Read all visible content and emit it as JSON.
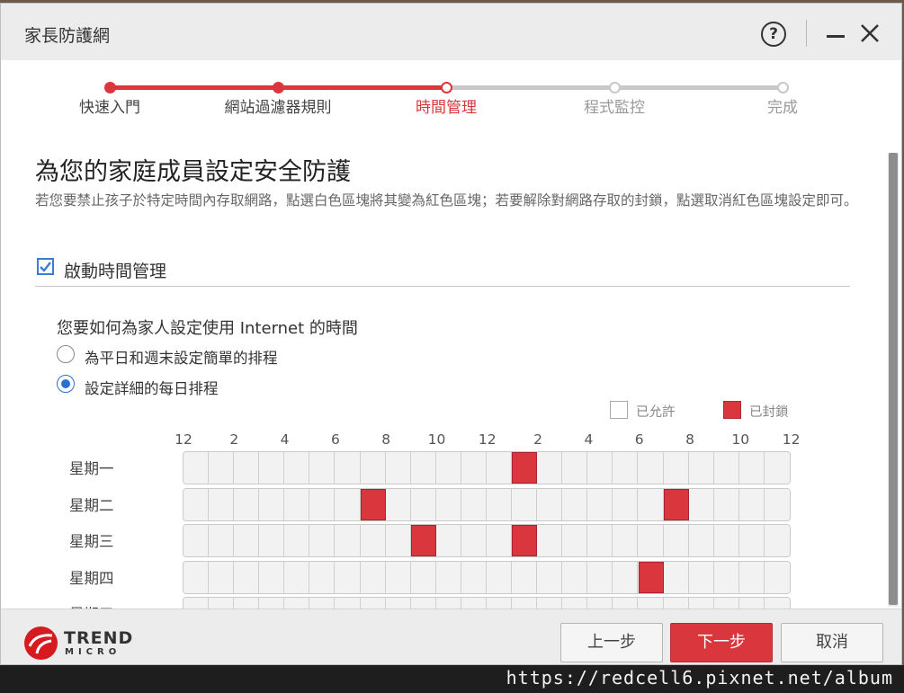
{
  "window": {
    "title": "家長防護網",
    "help_glyph": "?"
  },
  "steps": [
    {
      "label": "快速入門",
      "state": "done"
    },
    {
      "label": "網站過濾器規則",
      "state": "done"
    },
    {
      "label": "時間管理",
      "state": "current"
    },
    {
      "label": "程式監控",
      "state": "pending"
    },
    {
      "label": "完成",
      "state": "pending"
    }
  ],
  "colors": {
    "accent": "#d9363e",
    "pending": "#c8c8c8",
    "checkbox": "#3a7bd5"
  },
  "content": {
    "heading": "為您的家庭成員設定安全防護",
    "description": "若您要禁止孩子於特定時間內存取網路，點選白色區塊將其變為紅色區塊；若要解除對網路存取的封鎖，點選取消紅色區塊設定即可。",
    "enable_label": "啟動時間管理",
    "enable_checked": true,
    "question": "您要如何為家人設定使用 Internet 的時間",
    "options": [
      {
        "label": "為平日和週末設定簡單的排程",
        "selected": false
      },
      {
        "label": "設定詳細的每日排程",
        "selected": true
      }
    ],
    "legend": {
      "allowed": "已允許",
      "blocked": "已封鎖"
    }
  },
  "schedule": {
    "hour_labels": [
      "12",
      "2",
      "4",
      "6",
      "8",
      "10",
      "12",
      "2",
      "4",
      "6",
      "8",
      "10",
      "12"
    ],
    "cells_per_row": 24,
    "days": [
      {
        "label": "星期一",
        "blocked": [
          13
        ]
      },
      {
        "label": "星期二",
        "blocked": [
          7,
          19
        ]
      },
      {
        "label": "星期三",
        "blocked": [
          9,
          13
        ]
      },
      {
        "label": "星期四",
        "blocked": [
          18
        ]
      },
      {
        "label": "星期五",
        "blocked": []
      }
    ]
  },
  "footer": {
    "logo_line1": "TREND",
    "logo_line2": "MICRO",
    "prev": "上一步",
    "next": "下一步",
    "cancel": "取消"
  },
  "watermark": "https://redcell6.pixnet.net/album"
}
